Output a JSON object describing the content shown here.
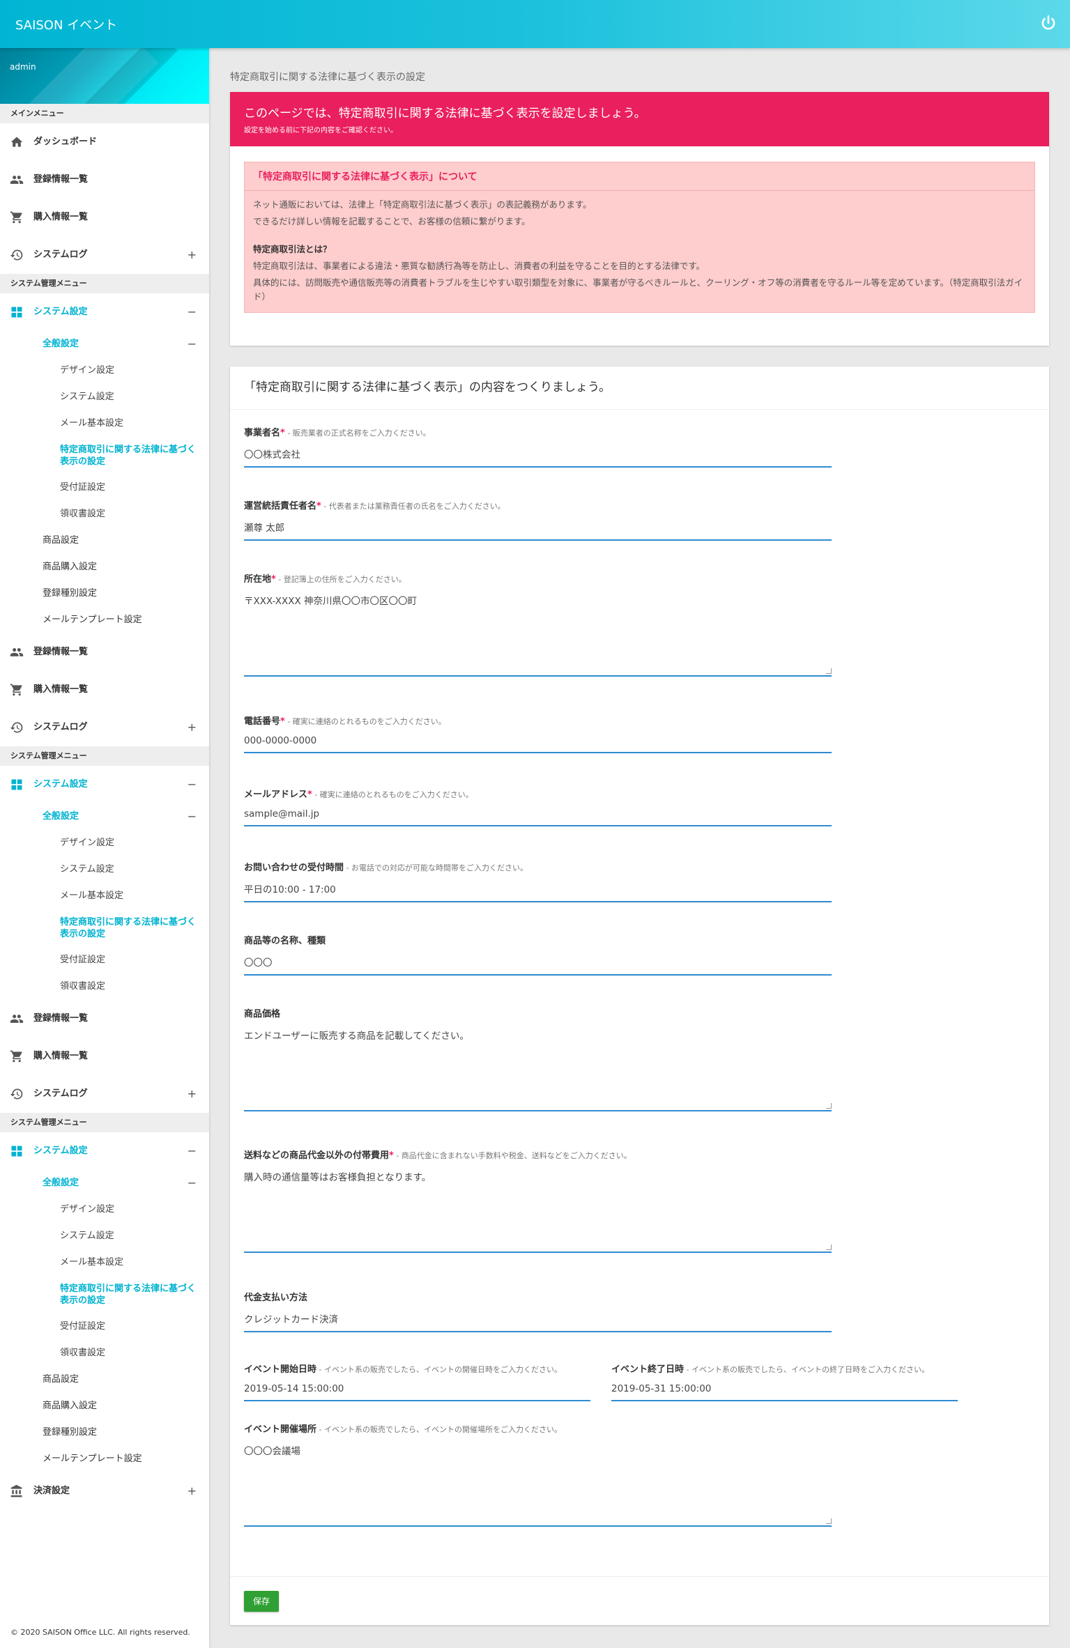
{
  "app": {
    "title": "SAISON イベント"
  },
  "sidebar": {
    "user": "admin",
    "main_menu_header": "メインメニュー",
    "sys_menu_header": "システム管理メニュー",
    "dashboard": "ダッシュボード",
    "registration_list": "登録情報一覧",
    "purchase_list": "購入情報一覧",
    "system_log": "システムログ",
    "system_settings": "システム設定",
    "general_settings": "全般設定",
    "design_settings": "デザイン設定",
    "system_config": "システム設定",
    "mail_basic": "メール基本設定",
    "tokushoho": "特定商取引に関する法律に基づく表示の設定",
    "receipt_cert": "受付証設定",
    "receipt": "領収書設定",
    "product_settings": "商品設定",
    "product_purchase": "商品購入設定",
    "registration_type": "登録種別設定",
    "mail_template": "メールテンプレート設定",
    "payment_settings": "決済設定",
    "copyright": "© 2020 SAISON Office LLC. All rights reserved."
  },
  "page": {
    "title": "特定商取引に関する法律に基づく表示の設定"
  },
  "intro": {
    "headline": "このページでは、特定商取引に関する法律に基づく表示を設定しましょう。",
    "subline": "設定を始める前に下記の内容をご確認ください。",
    "alert_title": "「特定商取引に関する法律に基づく表示」について",
    "p1": "ネット通販においては、法律上「特定商取引法に基づく表示」の表記義務があります。",
    "p2": "できるだけ詳しい情報を記載することで、お客様の信頼に繋がります。",
    "sub_heading": "特定商取引法とは？",
    "p3": "特定商取引法は、事業者による違法・悪質な勧誘行為等を防止し、消費者の利益を守ることを目的とする法律です。",
    "p4": "具体的には、訪問販売や通信販売等の消費者トラブルを生じやすい取引類型を対象に、事業者が守るべきルールと、クーリング・オフ等の消費者を守るルール等を定めています。（特定商取引法ガイド）"
  },
  "form": {
    "heading": "「特定商取引に関する法律に基づく表示」の内容をつくりましょう。",
    "business_name": {
      "label": "事業者名",
      "hint": " - 販売業者の正式名称をご入力ください。",
      "value": "〇〇株式会社"
    },
    "manager": {
      "label": "運営統括責任者名",
      "hint": " - 代表者または業務責任者の氏名をご入力ください。",
      "value": "瀬尊 太郎"
    },
    "address": {
      "label": "所在地",
      "hint": " - 登記簿上の住所をご入力ください。",
      "value": "〒XXX-XXXX 神奈川県〇〇市〇区〇〇町"
    },
    "phone": {
      "label": "電話番号",
      "hint": " - 確実に連絡のとれるものをご入力ください。",
      "value": "000-0000-0000"
    },
    "email": {
      "label": "メールアドレス",
      "hint": " - 確実に連絡のとれるものをご入力ください。",
      "value": "sample@mail.jp"
    },
    "hours": {
      "label": "お問い合わせの受付時間",
      "hint": " - お電話での対応が可能な時間帯をご入力ください。",
      "value": "平日の10:00 - 17:00"
    },
    "product_name": {
      "label": "商品等の名称、種類",
      "value": "〇〇〇"
    },
    "price": {
      "label": "商品価格",
      "value": "エンドユーザーに販売する商品を記載してください。"
    },
    "extra_cost": {
      "label": "送料などの商品代金以外の付帯費用",
      "hint": " - 商品代金に含まれない手数料や税金、送料などをご入力ください。",
      "value": "購入時の通信量等はお客様負担となります。"
    },
    "payment": {
      "label": "代金支払い方法",
      "value": "クレジットカード決済"
    },
    "event_start": {
      "label": "イベント開始日時",
      "hint": " - イベント系の販売でしたら、イベントの開催日時をご入力ください。",
      "value": "2019-05-14 15:00:00"
    },
    "event_end": {
      "label": "イベント終了日時",
      "hint": " - イベント系の販売でしたら、イベントの終了日時をご入力ください。",
      "value": "2019-05-31 15:00:00"
    },
    "event_place": {
      "label": "イベント開催場所",
      "hint": " - イベント系の販売でしたら、イベントの開催場所をご入力ください。",
      "value": "〇〇〇会議場"
    },
    "required_mark": "*",
    "save": "保存"
  },
  "colors": {
    "accent": "#00b3d1",
    "pink": "#ea1f5e",
    "input_line": "#2f8bd1",
    "save": "#2fa034"
  },
  "icons": [
    "home-icon",
    "people-icon",
    "cart-icon",
    "history-icon",
    "dashboard-icon",
    "bank-icon",
    "power-icon"
  ]
}
